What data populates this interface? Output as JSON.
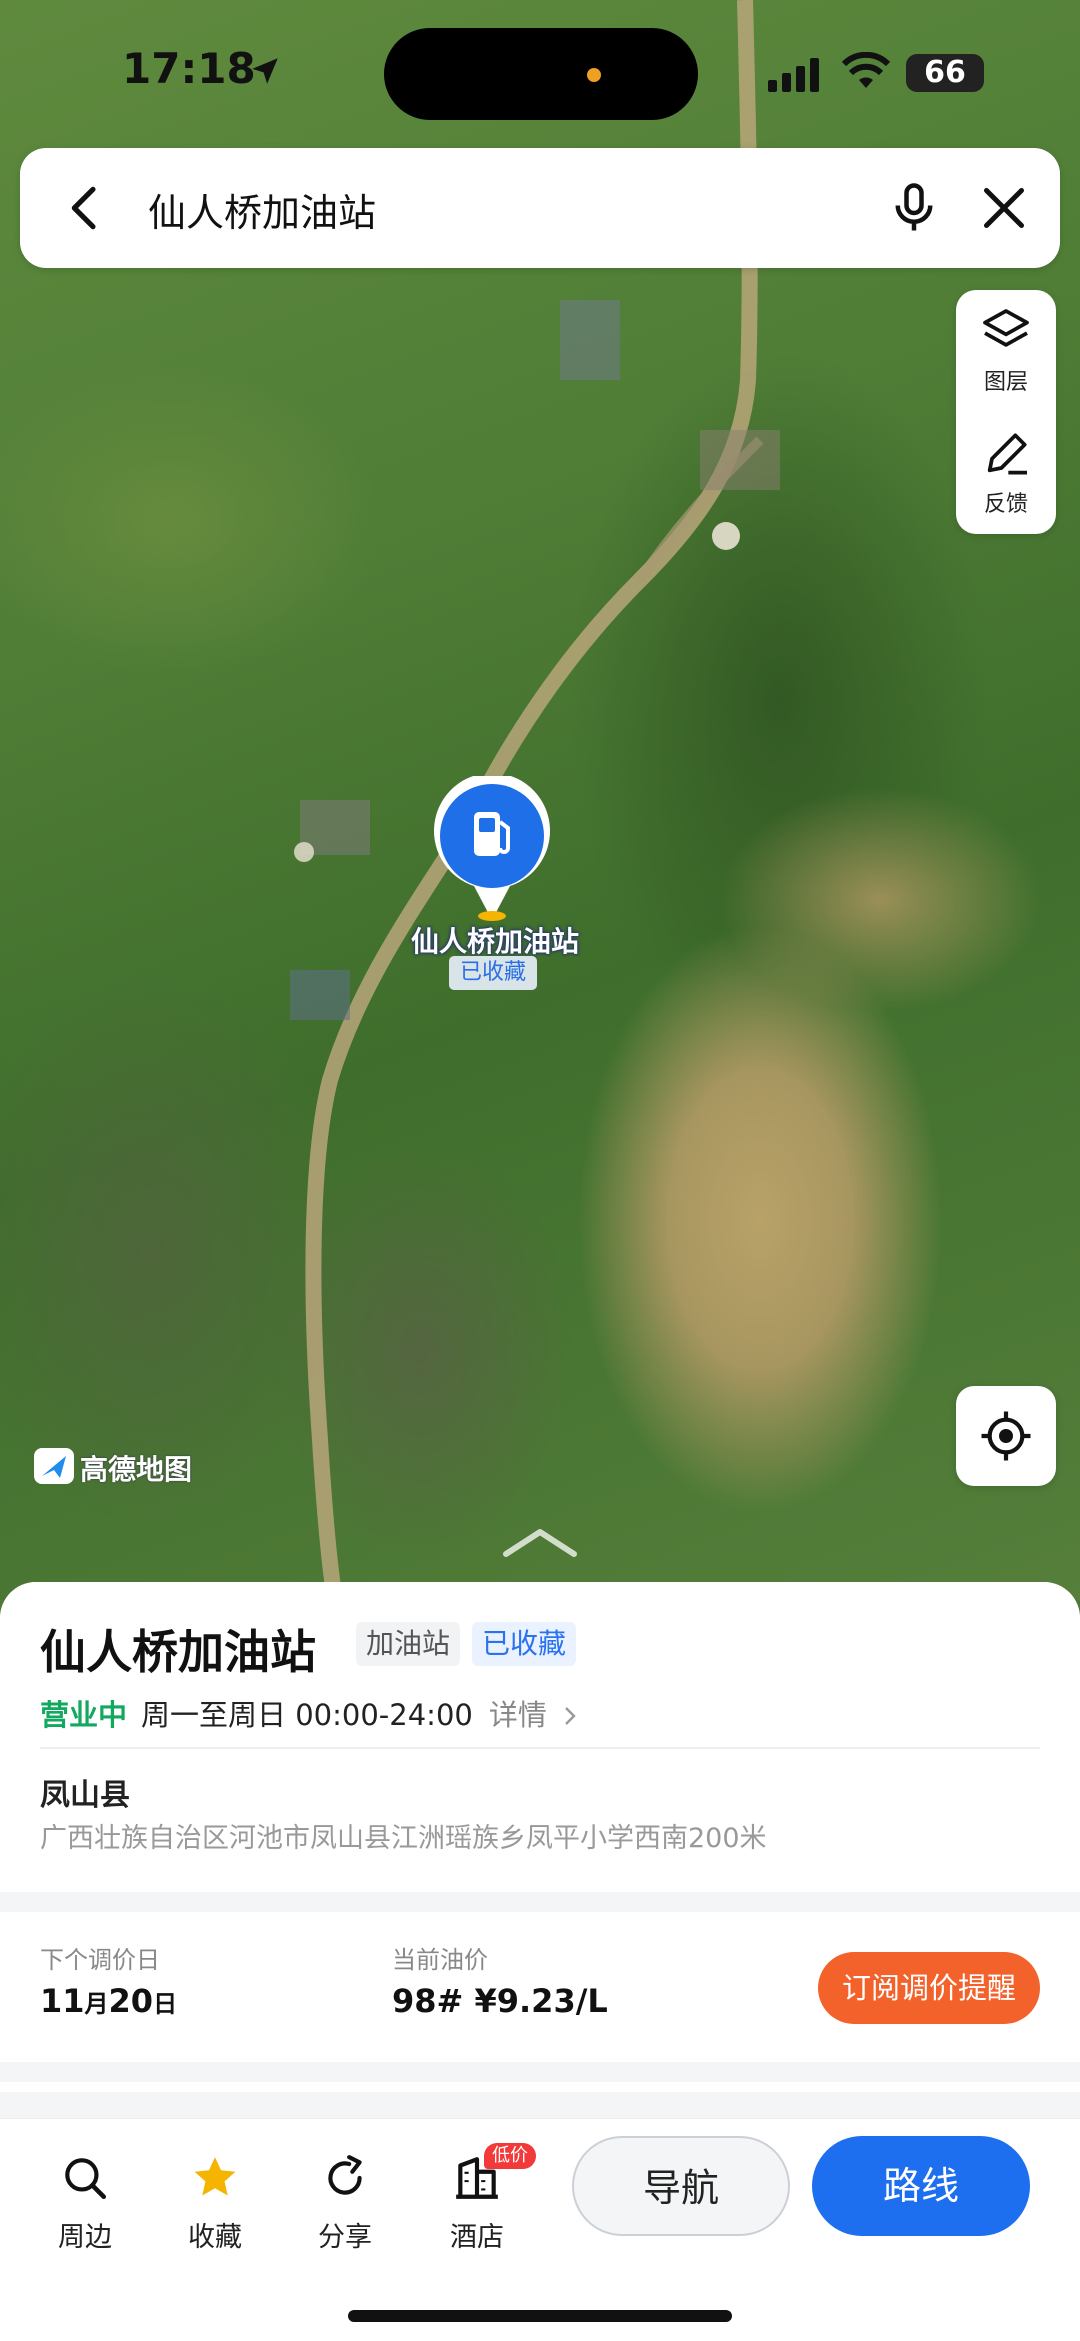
{
  "status_bar": {
    "time": "17:18",
    "battery": "66"
  },
  "search": {
    "query": "仙人桥加油站"
  },
  "map_tools": {
    "layers_label": "图层",
    "feedback_label": "反馈"
  },
  "pin": {
    "label": "仙人桥加油站",
    "sub_label": "已收藏"
  },
  "map_logo": {
    "text": "高德地图"
  },
  "poi": {
    "title": "仙人桥加油站",
    "category_tag": "加油站",
    "favorite_tag": "已收藏",
    "status": "营业中",
    "hours": "周一至周日 00:00-24:00",
    "detail_link": "详情",
    "county": "凤山县",
    "address": "广西壮族自治区河池市凤山县江洲瑶族乡凤平小学西南200米"
  },
  "fuel": {
    "next_adjust_label": "下个调价日",
    "next_adjust_month": "11",
    "month_unit": "月",
    "next_adjust_day": "20",
    "day_unit": "日",
    "current_price_label": "当前油价",
    "current_price": "98# ¥9.23/L",
    "subscribe_label": "订阅调价提醒"
  },
  "bottom_nav": {
    "nearby": "周边",
    "favorite": "收藏",
    "share": "分享",
    "hotel": "酒店",
    "hotel_badge": "低价",
    "navigate": "导航",
    "route": "路线"
  },
  "colors": {
    "accent_blue": "#1e6ff0",
    "open_green": "#12a860",
    "subscribe_orange": "#f4622c",
    "favorite_star": "#f5b400",
    "badge_red": "#f23a3a"
  },
  "icons": [
    "back-icon",
    "mic-icon",
    "close-icon",
    "layers-icon",
    "feedback-icon",
    "locate-icon",
    "gas-station-pin-icon",
    "search-icon",
    "star-icon",
    "share-icon",
    "hotel-icon",
    "chevron-right-icon"
  ]
}
